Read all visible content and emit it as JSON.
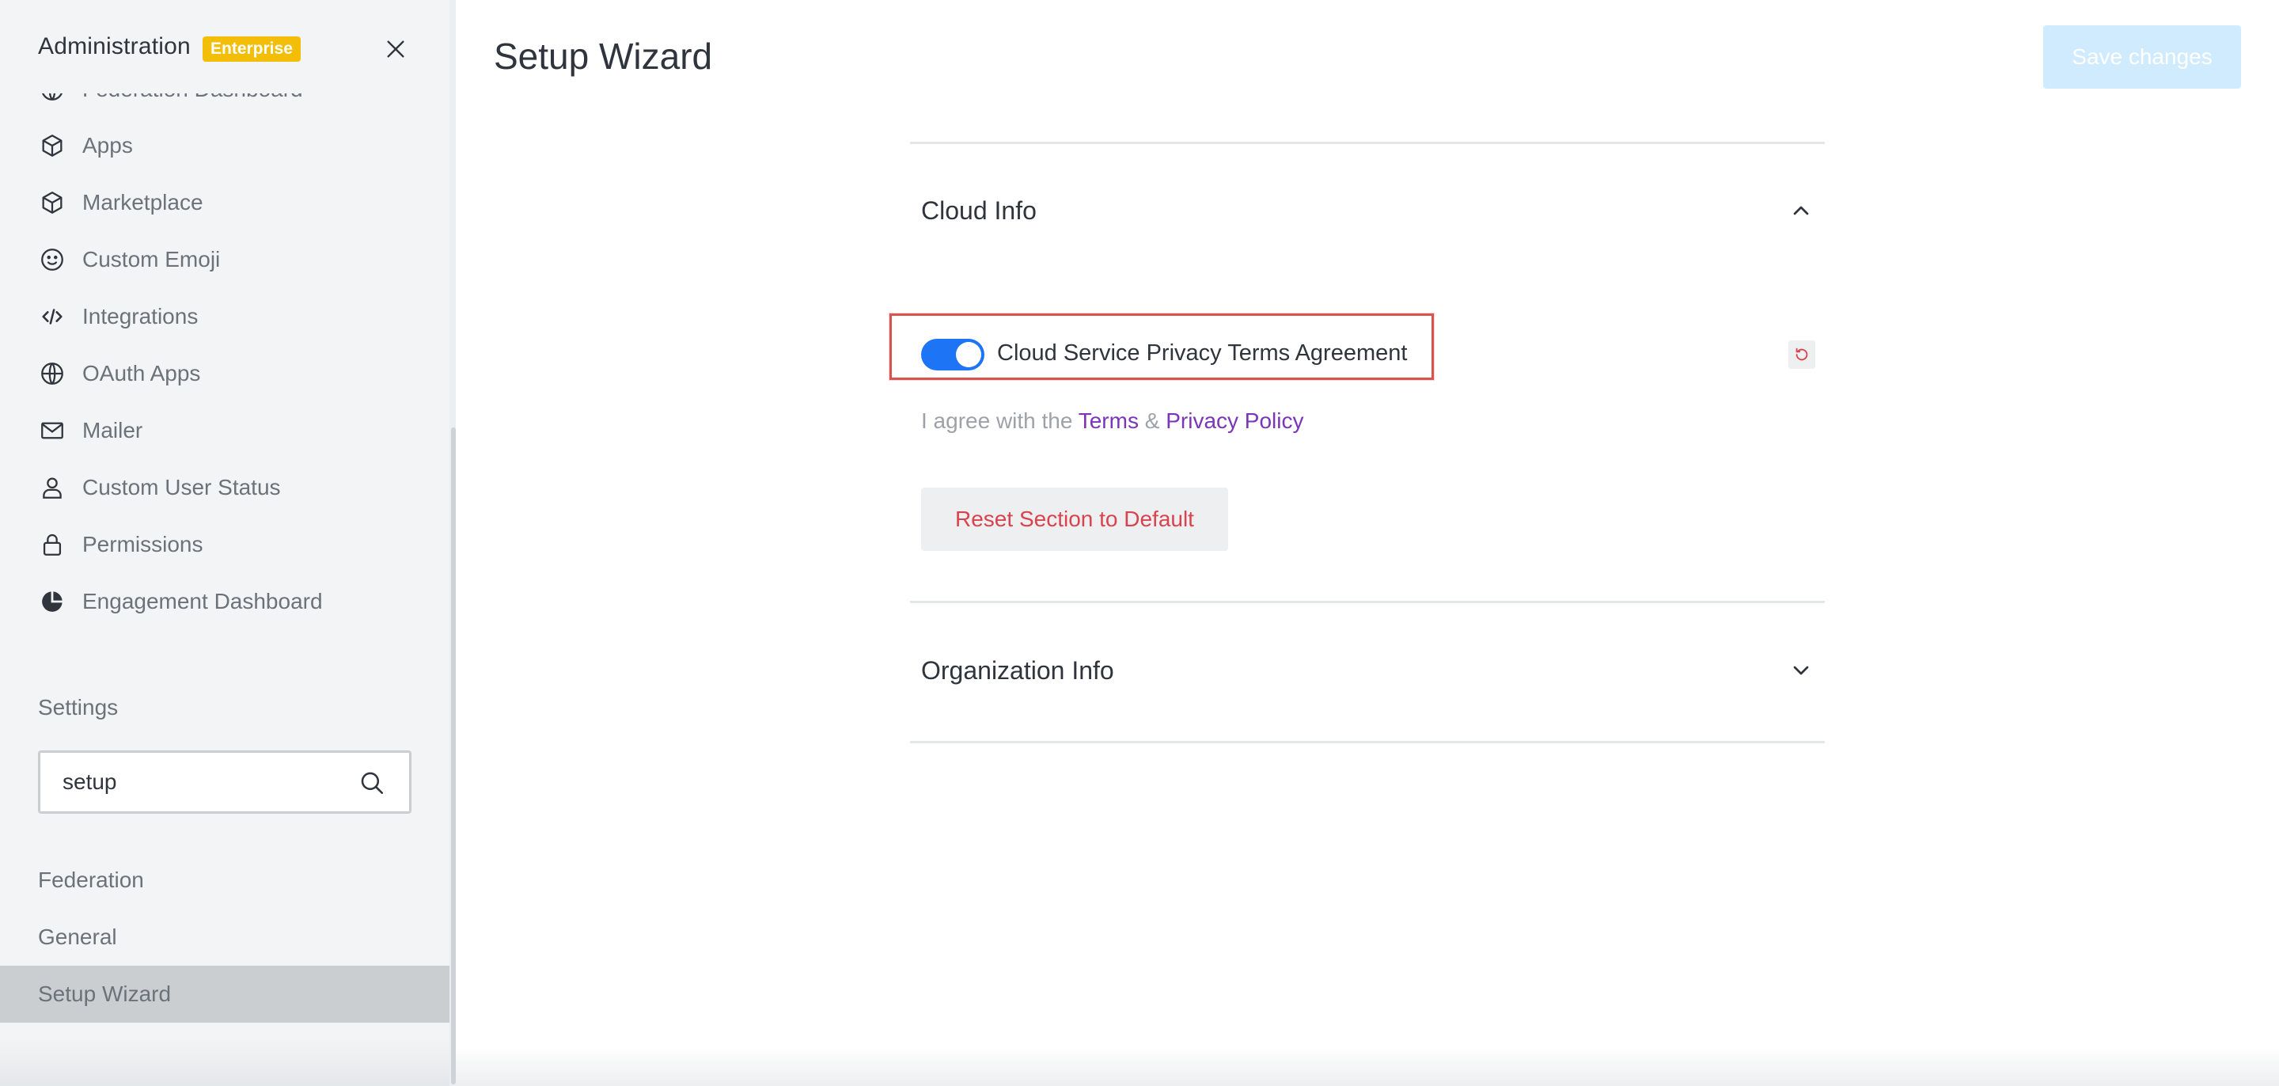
{
  "sidebar": {
    "title": "Administration",
    "badge": "Enterprise",
    "partial_item": "Federation Dashboard",
    "items": [
      {
        "label": "Apps",
        "icon": "cube-icon"
      },
      {
        "label": "Marketplace",
        "icon": "cube-icon"
      },
      {
        "label": "Custom Emoji",
        "icon": "emoji-icon"
      },
      {
        "label": "Integrations",
        "icon": "code-icon"
      },
      {
        "label": "OAuth Apps",
        "icon": "globe-icon"
      },
      {
        "label": "Mailer",
        "icon": "mail-icon"
      },
      {
        "label": "Custom User Status",
        "icon": "user-icon"
      },
      {
        "label": "Permissions",
        "icon": "lock-icon"
      },
      {
        "label": "Engagement Dashboard",
        "icon": "pie-chart-icon"
      }
    ],
    "settings_label": "Settings",
    "search": {
      "value": "setup",
      "placeholder": "Search"
    },
    "settings_items": [
      {
        "label": "Federation",
        "active": false
      },
      {
        "label": "General",
        "active": false
      },
      {
        "label": "Setup Wizard",
        "active": true
      }
    ]
  },
  "main": {
    "title": "Setup Wizard",
    "save_label": "Save changes",
    "sections": [
      {
        "title": "Cloud Info",
        "expanded": true
      },
      {
        "title": "Organization Info",
        "expanded": false
      }
    ],
    "setting": {
      "label": "Cloud Service Privacy Terms Agreement",
      "enabled": true,
      "hint_prefix": "I agree with the",
      "terms_link": "Terms",
      "amp": "&",
      "privacy_link": "Privacy Policy"
    },
    "reset_section_label": "Reset Section to Default"
  },
  "colors": {
    "accent": "#1d74f5",
    "badge": "#f3be08",
    "danger": "#d9434e",
    "link": "#7b35b8",
    "save_disabled": "#d1ebfe"
  }
}
